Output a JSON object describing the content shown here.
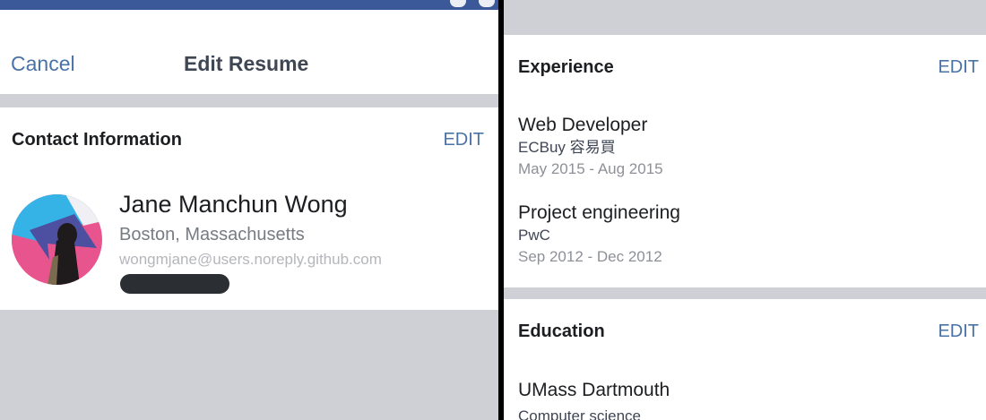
{
  "left_panel": {
    "nav": {
      "cancel_label": "Cancel",
      "title": "Edit Resume"
    },
    "contact_card": {
      "title": "Contact Information",
      "edit_label": "EDIT",
      "name": "Jane Manchun Wong",
      "location": "Boston, Massachusetts",
      "email": "wongmjane@users.noreply.github.com"
    }
  },
  "right_panel": {
    "experience": {
      "title": "Experience",
      "edit_label": "EDIT",
      "items": [
        {
          "title": "Web Developer",
          "company": "ECBuy 容易買",
          "dates": "May 2015 - Aug 2015"
        },
        {
          "title": "Project engineering",
          "company": "PwC",
          "dates": "Sep 2012 - Dec 2012"
        }
      ]
    },
    "education": {
      "title": "Education",
      "edit_label": "EDIT",
      "items": [
        {
          "school": "UMass Dartmouth",
          "field": "Computer science"
        }
      ]
    }
  },
  "colors": {
    "accent": "#4a72a6",
    "status_bar": "#3b5998",
    "background": "#cfd0d5"
  }
}
